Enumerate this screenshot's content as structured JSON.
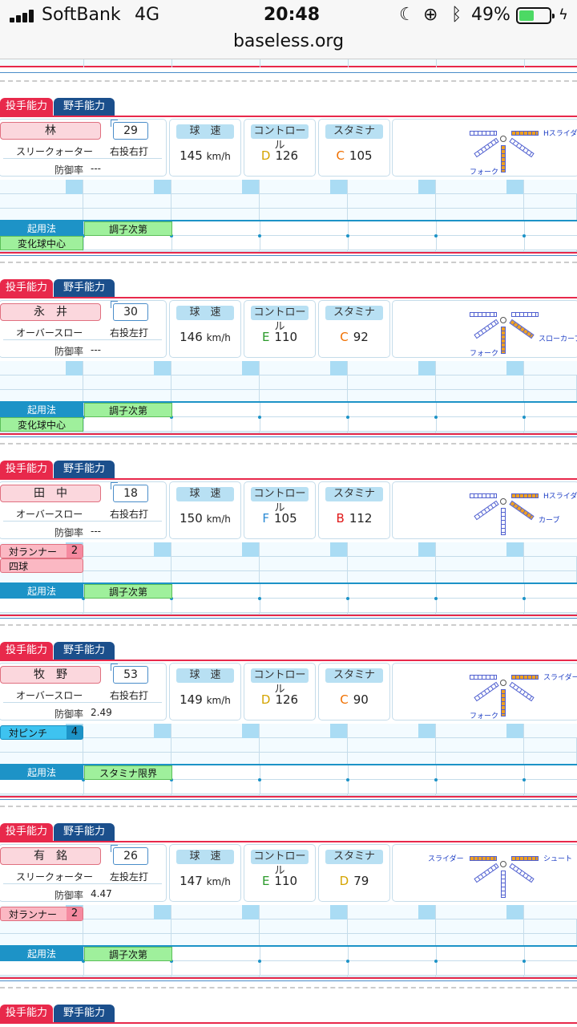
{
  "status_bar": {
    "carrier": "SoftBank",
    "network": "4G",
    "time": "20:48",
    "battery": "49%",
    "battery_level": 0.49
  },
  "url": "baseless.org",
  "tabs": {
    "pitcher": "投手能力",
    "fielder": "野手能力"
  },
  "labels": {
    "velocity": "球　速",
    "control": "コントロール",
    "stamina": "スタミナ",
    "era": "防御率",
    "kmh": "km/h"
  },
  "colors": {
    "tab_pitcher": "#e8294b",
    "tab_fielder": "#1b4f8c",
    "grade_D": "#d4a400",
    "grade_C": "#f07000",
    "grade_E": "#2a9a2a",
    "grade_F": "#2a8ad4",
    "grade_B": "#e01818"
  },
  "players": [
    {
      "name": "林",
      "number": "29",
      "form": "スリークォーター",
      "hand": "右投右打",
      "era": "---",
      "velocity": "145",
      "control_grade": "D",
      "control": "126",
      "stamina_grade": "C",
      "stamina": "105",
      "pitches": [
        {
          "name": "Hスライダー",
          "dir": "right"
        },
        {
          "name": "フォーク",
          "dir": "down"
        }
      ],
      "special": [],
      "usage": "起用法",
      "usage_value": "調子次第",
      "extra": "変化球中心"
    },
    {
      "name": "永　井",
      "number": "30",
      "form": "オーバースロー",
      "hand": "右投左打",
      "era": "---",
      "velocity": "146",
      "control_grade": "E",
      "control": "110",
      "stamina_grade": "C",
      "stamina": "92",
      "pitches": [
        {
          "name": "スローカーブ",
          "dir": "downright"
        },
        {
          "name": "フォーク",
          "dir": "down"
        }
      ],
      "special": [],
      "usage": "起用法",
      "usage_value": "調子次第",
      "extra": "変化球中心"
    },
    {
      "name": "田　中",
      "number": "18",
      "form": "オーバースロー",
      "hand": "右投右打",
      "era": "---",
      "velocity": "150",
      "control_grade": "F",
      "control": "105",
      "stamina_grade": "B",
      "stamina": "112",
      "pitches": [
        {
          "name": "Hスライダー",
          "dir": "right"
        },
        {
          "name": "カーブ",
          "dir": "downright"
        }
      ],
      "special": [
        {
          "name": "対ランナー",
          "level": "2",
          "style": "pink"
        },
        {
          "name": "四球",
          "level": "",
          "style": "pink"
        }
      ],
      "usage": "起用法",
      "usage_value": "調子次第",
      "extra": ""
    },
    {
      "name": "牧　野",
      "number": "53",
      "form": "オーバースロー",
      "hand": "右投右打",
      "era": "2.49",
      "velocity": "149",
      "control_grade": "D",
      "control": "126",
      "stamina_grade": "C",
      "stamina": "90",
      "pitches": [
        {
          "name": "スライダー",
          "dir": "right"
        },
        {
          "name": "フォーク",
          "dir": "down"
        }
      ],
      "special": [
        {
          "name": "対ピンチ",
          "level": "4",
          "style": "cyan"
        }
      ],
      "usage": "起用法",
      "usage_value": "スタミナ限界",
      "extra": ""
    },
    {
      "name": "有　銘",
      "number": "26",
      "form": "スリークォーター",
      "hand": "左投左打",
      "era": "4.47",
      "velocity": "147",
      "control_grade": "E",
      "control": "110",
      "stamina_grade": "D",
      "stamina": "79",
      "pitches": [
        {
          "name": "スライダー",
          "dir": "left"
        },
        {
          "name": "シュート",
          "dir": "right"
        }
      ],
      "special": [
        {
          "name": "対ランナー",
          "level": "2",
          "style": "pink"
        }
      ],
      "usage": "起用法",
      "usage_value": "調子次第",
      "extra": ""
    }
  ]
}
